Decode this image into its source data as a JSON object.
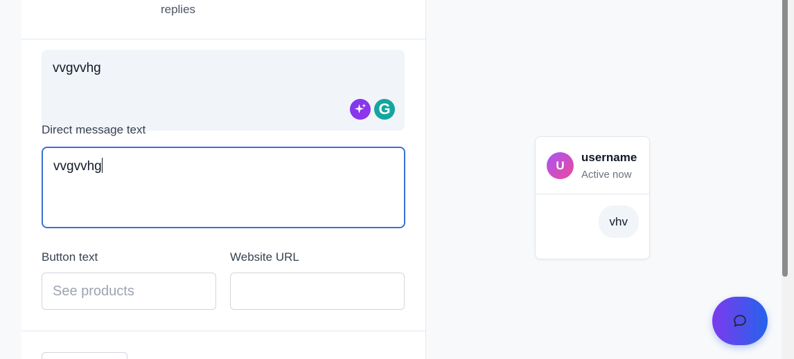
{
  "editor": {
    "replies_label": "replies",
    "public_reply_text": "vvgvvhg",
    "dm_label": "Direct message text",
    "dm_text": "vvgvvhg",
    "button_text_label": "Button text",
    "button_text_placeholder": "See products",
    "website_url_label": "Website URL",
    "website_url_value": ""
  },
  "preview": {
    "avatar_initial": "U",
    "username": "username",
    "status": "Active now",
    "message": "vhv"
  },
  "icons": {
    "ai": "sparkles-icon",
    "grammarly": "grammarly-icon",
    "chat": "chat-bubble-icon"
  },
  "grammarly_letter": "G",
  "colors": {
    "accent_blue": "#3b6fd4",
    "fab_gradient_start": "#7c3aed",
    "fab_gradient_end": "#2563eb",
    "avatar_gradient_start": "#a855f7",
    "avatar_gradient_end": "#ec4899"
  }
}
